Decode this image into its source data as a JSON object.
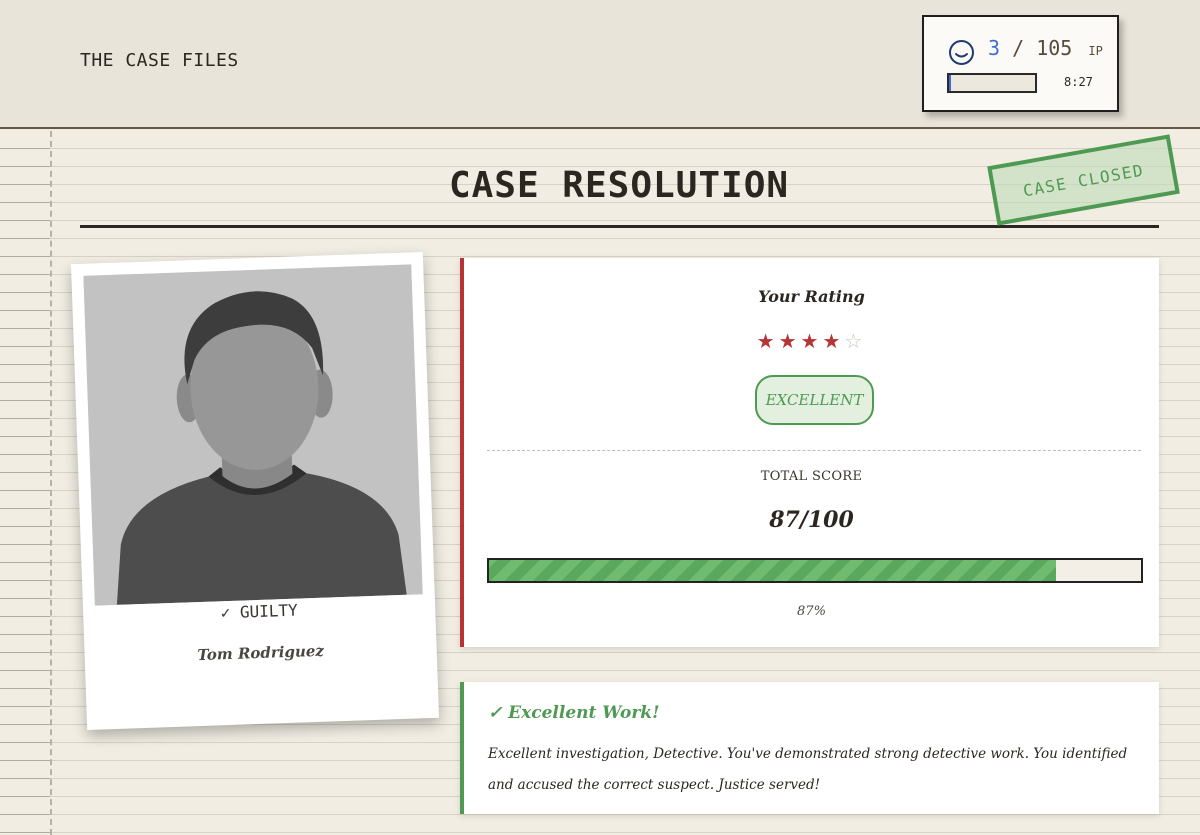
{
  "header": {
    "brand": "THE CASE FILES",
    "ip": {
      "current": "3",
      "separator": "/",
      "max": "105",
      "unit": "IP",
      "progress_fraction": 0.029,
      "timer": "8:27",
      "icon": "smiley-face-icon"
    }
  },
  "page": {
    "title": "CASE RESOLUTION",
    "stamp": "CASE CLOSED"
  },
  "suspect": {
    "photo_icon": "suspect-silhouette-icon",
    "verdict": "✓ GUILTY",
    "name": "Tom Rodriguez"
  },
  "rating": {
    "label": "Your Rating",
    "stars_filled": 4,
    "stars_total": 5,
    "badge": "EXCELLENT",
    "score_label": "TOTAL SCORE",
    "score_value": "87/100",
    "score_percent_value": 87,
    "score_percent_text": "87%"
  },
  "feedback": {
    "title": "✓ Excellent Work!",
    "text": "Excellent investigation, Detective. You've demonstrated strong detective work. You identified and accused the correct suspect. Justice served!"
  },
  "colors": {
    "accent_red": "#b73434",
    "accent_green": "#4f9a53",
    "ip_blue": "#3b6fd0",
    "paper": "#f1ede3"
  }
}
